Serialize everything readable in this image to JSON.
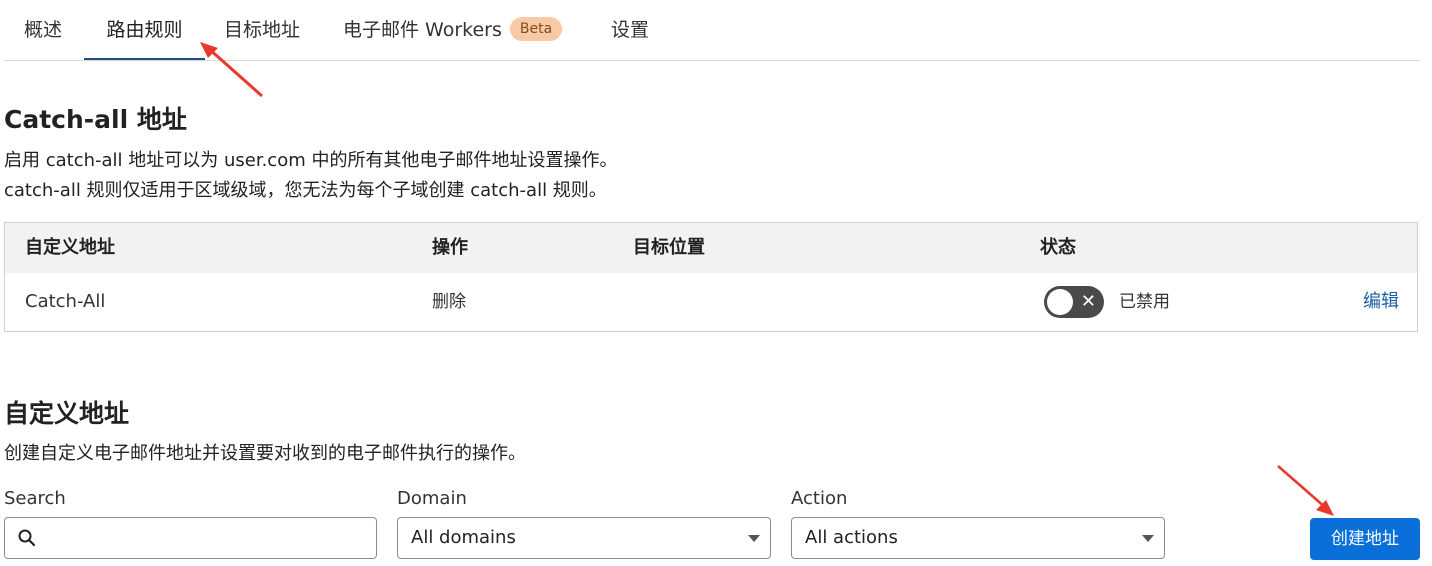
{
  "tabs": {
    "overview": "概述",
    "routing_rules": "路由规则",
    "destination_addresses": "目标地址",
    "email_workers": "电子邮件 Workers",
    "beta_badge": "Beta",
    "settings": "设置",
    "active": "routing_rules"
  },
  "catch_all": {
    "title": "Catch-all 地址",
    "desc_line1": "启用 catch-all 地址可以为 user.com 中的所有其他电子邮件地址设置操作。",
    "desc_line2": "catch-all 规则仅适用于区域级域，您无法为每个子域创建 catch-all 规则。",
    "table": {
      "headers": [
        "自定义地址",
        "操作",
        "目标位置",
        "状态"
      ],
      "row": {
        "address": "Catch-All",
        "action": "删除",
        "destination": "",
        "status": "已禁用",
        "enabled": false,
        "edit": "编辑"
      }
    }
  },
  "custom": {
    "title": "自定义地址",
    "desc": "创建自定义电子邮件地址并设置要对收到的电子邮件执行的操作。",
    "search_label": "Search",
    "search_value": "",
    "domain_label": "Domain",
    "domain_value": "All domains",
    "action_label": "Action",
    "action_value": "All actions",
    "create_button": "创建地址"
  },
  "colors": {
    "accent": "#0a6fd8",
    "link": "#1f5fa8",
    "annotation_arrow": "#e8382a",
    "beta_bg": "#f8c9a6"
  },
  "icons": {
    "search": "search-icon",
    "toggle_off": "close-icon",
    "dropdown": "chevron-down-icon"
  }
}
